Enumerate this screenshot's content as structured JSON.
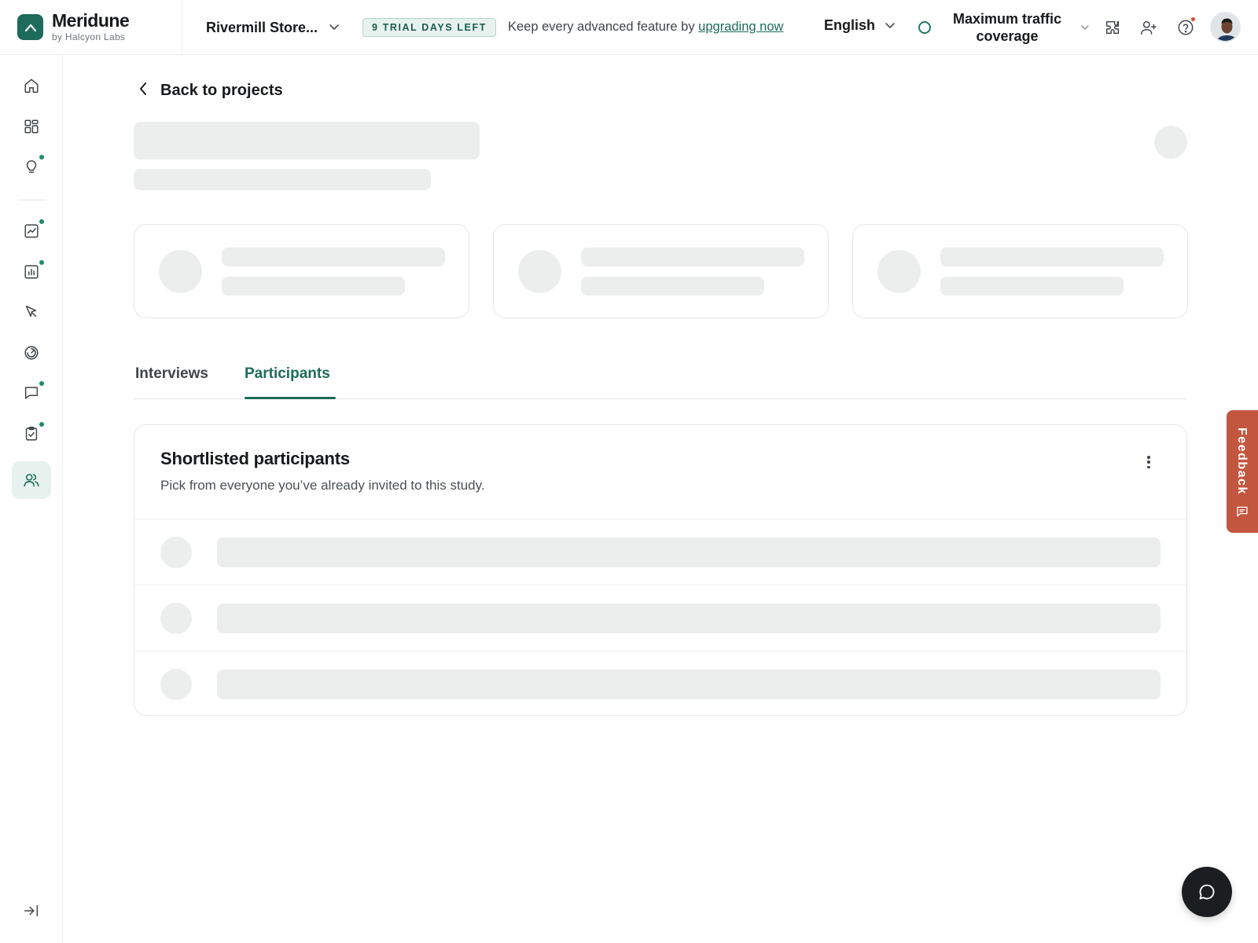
{
  "app": {
    "brand_name": "Meridune",
    "brand_sub": "by Halcyon Labs",
    "accent_color": "#1d6b5a"
  },
  "header": {
    "store_name": "Rivermill Store...",
    "trial_badge": "9 TRIAL DAYS LEFT",
    "upgrade_prefix": "Keep every advanced feature by ",
    "upgrade_link": "upgrading now",
    "language": "English",
    "traffic_label": "Maximum traffic coverage",
    "icons": [
      "integrations-icon",
      "invite-user-icon",
      "help-icon"
    ]
  },
  "sidebar": {
    "items": [
      {
        "name": "home",
        "icon": "home-icon",
        "dot": false,
        "active": false
      },
      {
        "name": "dashboards",
        "icon": "grid-icon",
        "dot": false,
        "active": false
      },
      {
        "name": "insights",
        "icon": "lightbulb-icon",
        "dot": true,
        "active": false
      },
      {
        "name": "trends",
        "icon": "line-chart-icon",
        "dot": true,
        "active": false
      },
      {
        "name": "reports",
        "icon": "bar-chart-icon",
        "dot": true,
        "active": false
      },
      {
        "name": "clicks",
        "icon": "cursor-icon",
        "dot": false,
        "active": false
      },
      {
        "name": "recordings",
        "icon": "replay-icon",
        "dot": false,
        "active": false
      },
      {
        "name": "feedback",
        "icon": "chat-icon",
        "dot": true,
        "active": false
      },
      {
        "name": "surveys",
        "icon": "clipboard-icon",
        "dot": true,
        "active": false
      },
      {
        "name": "participants",
        "icon": "users-icon",
        "dot": false,
        "active": true
      }
    ],
    "collapse_icon": "expand-sidebar-icon"
  },
  "main": {
    "back_label": "Back to projects",
    "tabs": [
      {
        "label": "Interviews",
        "active": false
      },
      {
        "label": "Participants",
        "active": true
      }
    ],
    "panel": {
      "title": "Shortlisted participants",
      "description": "Pick from everyone you’ve already invited to this study.",
      "loading_rows": 3
    },
    "stat_cards_loading": 3
  },
  "feedback_tab": {
    "label": "Feedback",
    "color": "#c3563f"
  }
}
